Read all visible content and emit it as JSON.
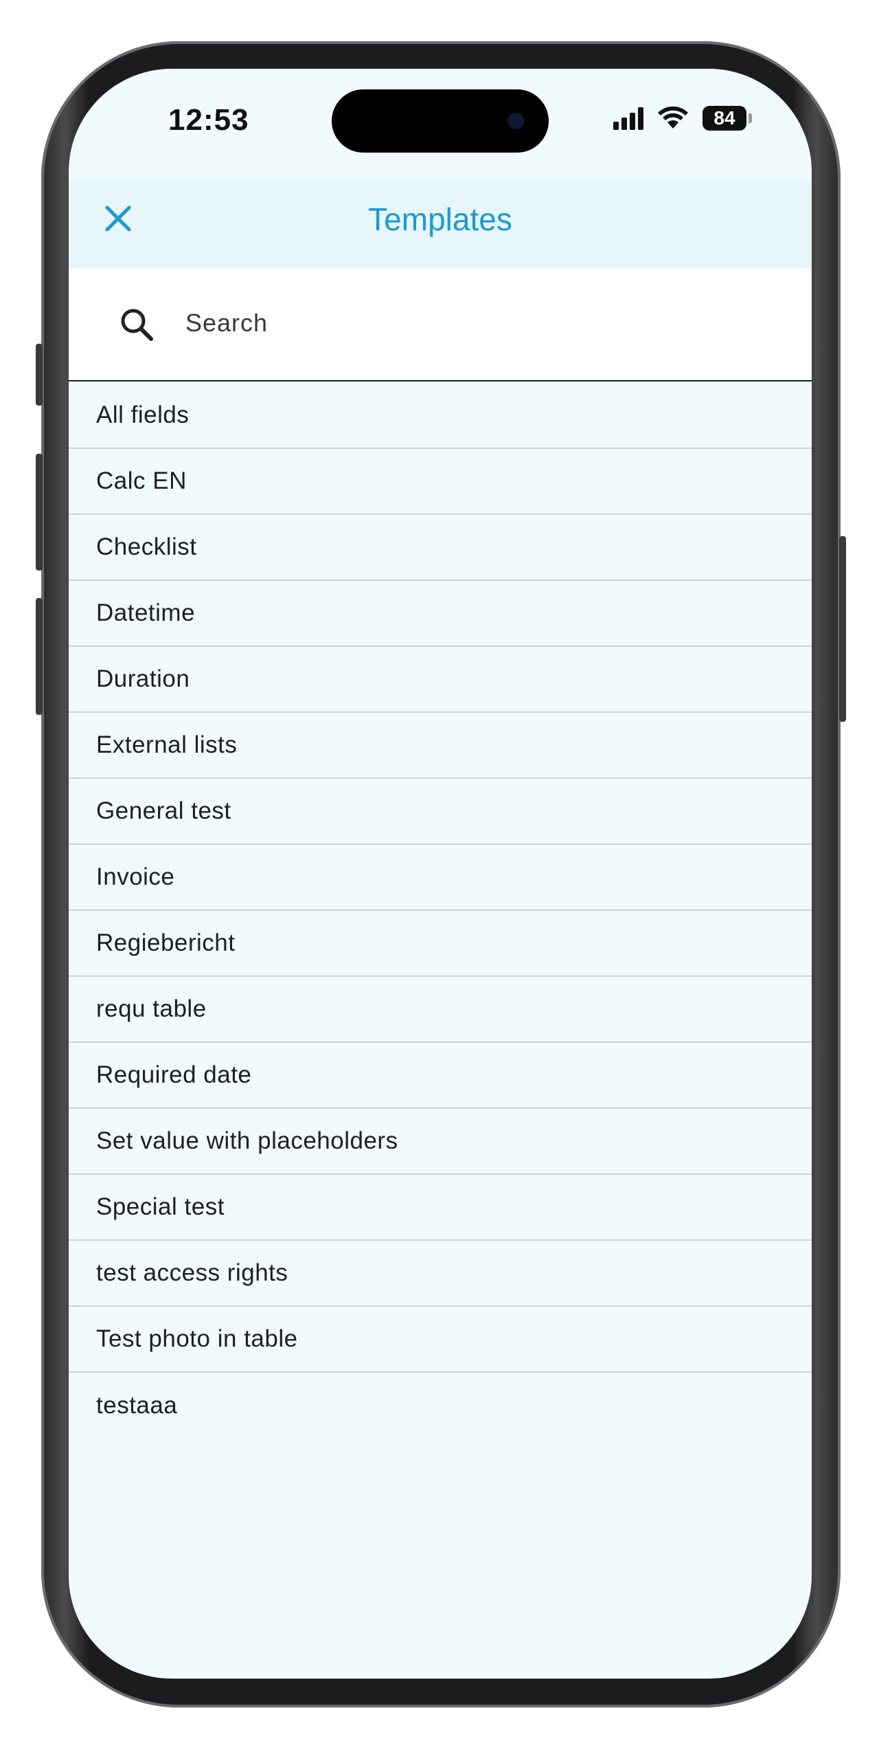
{
  "status_bar": {
    "time": "12:53",
    "battery": "84"
  },
  "header": {
    "title": "Templates",
    "close_icon": "close-icon",
    "accent_color": "#1c9ad6"
  },
  "search": {
    "placeholder": "Search",
    "value": ""
  },
  "templates": [
    {
      "label": "All fields"
    },
    {
      "label": "Calc EN"
    },
    {
      "label": "Checklist"
    },
    {
      "label": "Datetime"
    },
    {
      "label": "Duration"
    },
    {
      "label": "External lists"
    },
    {
      "label": "General test"
    },
    {
      "label": "Invoice"
    },
    {
      "label": "Regiebericht"
    },
    {
      "label": "requ table"
    },
    {
      "label": "Required date"
    },
    {
      "label": "Set value with placeholders"
    },
    {
      "label": "Special test"
    },
    {
      "label": "test access rights"
    },
    {
      "label": "Test photo in table"
    },
    {
      "label": "testaaa"
    }
  ]
}
